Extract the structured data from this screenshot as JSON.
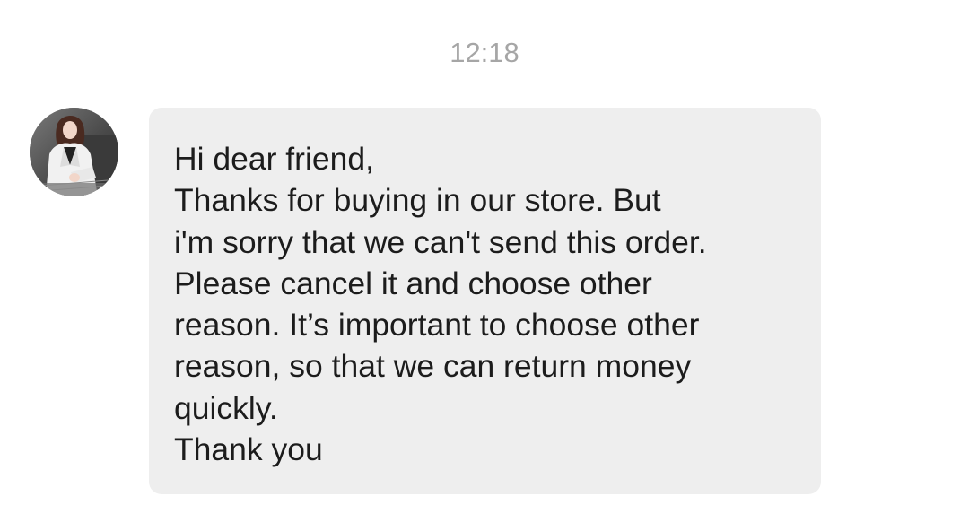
{
  "chat": {
    "timestamp": "12:18",
    "message": {
      "sender_avatar_icon": "profile-photo-avatar",
      "lines": [
        "Hi dear friend,",
        "Thanks for buying in our store. But",
        "i'm sorry that we can't send this order.",
        "Please cancel it and choose other",
        "reason. It’s important to choose other",
        "reason, so that we can return money",
        "quickly.",
        "Thank you"
      ]
    }
  }
}
